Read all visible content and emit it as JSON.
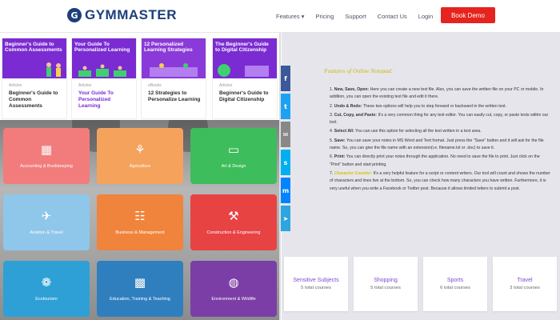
{
  "header": {
    "logo_mark": "G",
    "logo_text": "GYMMASTER",
    "nav": [
      "Features ▾",
      "Pricing",
      "Support",
      "Contact Us",
      "Login"
    ],
    "demo_label": "Book Demo"
  },
  "articles": [
    {
      "image_title": "Beginner's Guide to Common Assessments",
      "type": "Articles",
      "title": "Beginner's Guide to Common Assessments",
      "color": "#7a2bd1"
    },
    {
      "image_title": "Your Guide To Personalized Learning",
      "type": "Articles",
      "title": "Your Guide To Personalized Learning",
      "color": "#7a2bd1"
    },
    {
      "image_title": "12 Personalized Learning Strategies",
      "type": "eBooks",
      "title": "12 Strategies to Personalize Learning",
      "color": "#8a3ad8"
    },
    {
      "image_title": "The Beginner's Guide to Digital Citizenship",
      "type": "Articles",
      "title": "Beginner's Guide to Digital Citizenship",
      "color": "#7a2bd1"
    }
  ],
  "categories": [
    {
      "label": "Accounting & Bookkeeping",
      "icon": "calculator-icon",
      "glyph": "▦",
      "color": "#f27c7c"
    },
    {
      "label": "Agriculture",
      "icon": "plant-icon",
      "glyph": "⚘",
      "color": "#f5a25d"
    },
    {
      "label": "Art & Design",
      "icon": "monitor-icon",
      "glyph": "▭",
      "color": "#3dbd5b"
    },
    {
      "label": "Aviation & Travel",
      "icon": "airplane-icon",
      "glyph": "✈",
      "color": "#8ec7ea"
    },
    {
      "label": "Business & Management",
      "icon": "chart-icon",
      "glyph": "☷",
      "color": "#f0843c"
    },
    {
      "label": "Construction & Engineering",
      "icon": "crane-icon",
      "glyph": "⚒",
      "color": "#e84343"
    },
    {
      "label": "Ecotourism",
      "icon": "leaf-icon",
      "glyph": "❁",
      "color": "#2ea0d6"
    },
    {
      "label": "Education, Training & Teaching",
      "icon": "graduation-icon",
      "glyph": "▩",
      "color": "#2f7fbf"
    },
    {
      "label": "Environment & Wildlife",
      "icon": "globe-icon",
      "glyph": "◍",
      "color": "#7b3ea6"
    }
  ],
  "social": [
    {
      "icon": "facebook-icon",
      "glyph": "f",
      "color": "#3b5998"
    },
    {
      "icon": "twitter-icon",
      "glyph": "t",
      "color": "#1da1f2"
    },
    {
      "icon": "email-icon",
      "glyph": "✉",
      "color": "#888888"
    },
    {
      "icon": "skype-icon",
      "glyph": "s",
      "color": "#00aff0"
    },
    {
      "icon": "messenger-icon",
      "glyph": "m",
      "color": "#0084ff"
    },
    {
      "icon": "telegram-icon",
      "glyph": "➤",
      "color": "#2ca5e0"
    }
  ],
  "features_heading": "Features of Online Notepad:",
  "features": [
    {
      "n": "1.",
      "bold": "New, Save, Open:",
      "text": " Here you can create a new text file. Also, you can save the written file on your PC or mobile. In addition, you can open the existing text file and edit it there."
    },
    {
      "n": "2.",
      "bold": "Undo & Redo:",
      "text": " These two options will help you to step forward or backward in the written text."
    },
    {
      "n": "3.",
      "bold": "Cut, Copy, and Paste:",
      "text": " It's a very common thing for any text editor. You can easily cut, copy, or paste texts within our tool."
    },
    {
      "n": "4.",
      "bold": "Select All:",
      "text": " You can use this option for selecting all the text written in a text area."
    },
    {
      "n": "5.",
      "bold": "Save:",
      "text": " You can save your notes in MS Word and Text format. Just press the \"Save\" button and it will ask for the file name. So, you can give the file name with an extension(i.e. filename.txt or .doc) to save it."
    },
    {
      "n": "6.",
      "bold": "Print:",
      "text": " You can directly print your notes through the application. No need to save the file to print. Just click on the \"Print\" button and start printing."
    },
    {
      "n": "7.",
      "bold": "Character Counter:",
      "text": " It's a very helpful feature for a script or content writers. Our tool will count and shows the number of characters and lines live at the bottom. So, you can check how many characters you have written. Furthermore, it is very useful when you write a Facebook or Twitter post. Because it allows limited letters to submit a post.",
      "highlight": true
    }
  ],
  "subjects": [
    {
      "name": "Sensitive Subjects",
      "count": "5 total courses"
    },
    {
      "name": "Shopping",
      "count": "5 total courses"
    },
    {
      "name": "Sports",
      "count": "6 total courses"
    },
    {
      "name": "Travel",
      "count": "3 total courses"
    }
  ]
}
